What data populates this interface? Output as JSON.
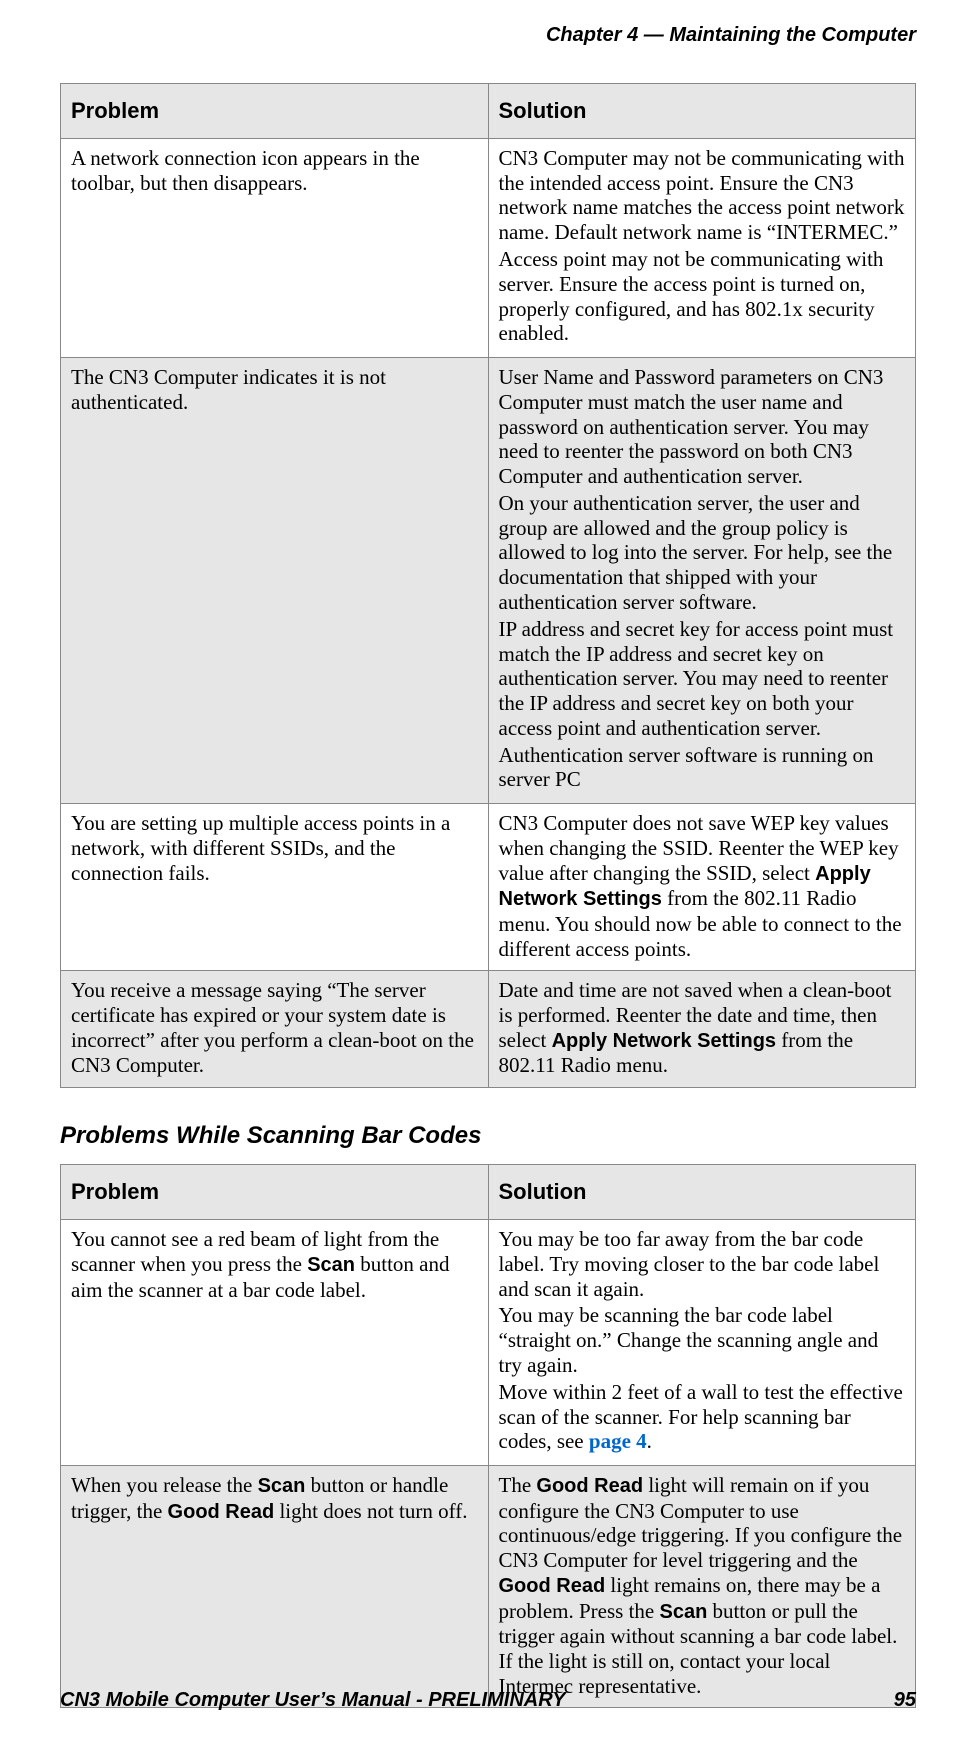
{
  "header": {
    "chapter_line": "Chapter 4 —  Maintaining the Computer"
  },
  "table1": {
    "head": {
      "problem": "Problem",
      "solution": "Solution"
    },
    "rows": [
      {
        "problem": "A network connection icon appears in the toolbar, but then disappears.",
        "sol_p1": "CN3 Computer may not be communicating with the intended access point. Ensure the CN3 network name matches the access point network name. Default network name is “INTERMEC.”",
        "sol_p2": "Access point may not be communicating with server. Ensure the access point is turned on, properly configured, and has 802.1x security enabled."
      },
      {
        "problem": "The CN3 Computer indicates it is not authenticated.",
        "sol_p1": "User Name and Password parameters on CN3 Computer must match the user name and password on authentica­tion server. You may need to reenter the password on both CN3 Computer and authentication server.",
        "sol_p2": "On your authentication server, the user and group are allowed and the group policy is allowed to log into the server. For help, see the documentation that shipped with your authentication server software.",
        "sol_p3": "IP address and secret key for access point must match the IP address and secret key on authentication server. You may need to reenter the IP address and secret key on both your access point and authentication server.",
        "sol_p4": "Authentication server software is running on server PC"
      },
      {
        "problem": "You are setting up multiple access points in a network, with different SSIDs, and the connection fails.",
        "sol_pre": "CN3 Computer does not save WEP key values when changing the SSID. Reenter the WEP key value after changing the SSID, select ",
        "sol_bold": "Apply Network Settings",
        "sol_post": " from the 802.11 Radio menu. You should now be able to con­nect to the different access points."
      },
      {
        "problem": "You receive a message saying “The server certificate has expired or your system date is incorrect” after you per­form a clean-boot on the CN3 Computer.",
        "sol_pre": "Date and time are not saved when a clean-boot is per­formed. Reenter the date and time, then select ",
        "sol_bold": "Apply Network Settings",
        "sol_post": " from the 802.11 Radio menu."
      }
    ]
  },
  "subheading": "Problems While Scanning Bar Codes",
  "table2": {
    "head": {
      "problem": "Problem",
      "solution": "Solution"
    },
    "rows": [
      {
        "prob_pre": "You cannot see a red beam of light from the scanner when you press the ",
        "prob_bold": "Scan",
        "prob_post": " button and aim the scanner at a bar code label.",
        "sol_p1": "You may be too far away from the bar code label. Try moving closer to the bar code label and scan it again.",
        "sol_p2": "You may be scanning the bar code label “straight on.” Change the scanning angle and try again.",
        "sol_p3_pre": "Move within 2 feet of a wall to test the effective scan of the scanner. For help scanning bar codes, see ",
        "sol_p3_link": "page 4",
        "sol_p3_post": "."
      },
      {
        "prob_pre": "When you release the ",
        "prob_bold1": "Scan",
        "prob_mid": " button or handle trigger, the ",
        "prob_bold2": "Good Read",
        "prob_post": " light does not turn off.",
        "sol_pre1": "The ",
        "sol_b1": "Good Read",
        "sol_mid1": " light will remain on if you configure the CN3 Computer to use continuous/edge triggering. If you configure the CN3 Computer for level triggering and the ",
        "sol_b2": "Good Read",
        "sol_mid2": " light remains on, there may be a problem. Press the ",
        "sol_b3": "Scan",
        "sol_post": " button or pull the trigger again without scanning a bar code label. If the light is still on, contact your local Intermec representative."
      }
    ]
  },
  "footer": {
    "left": "CN3 Mobile Computer User’s Manual - PRELIMINARY",
    "right": "95"
  }
}
